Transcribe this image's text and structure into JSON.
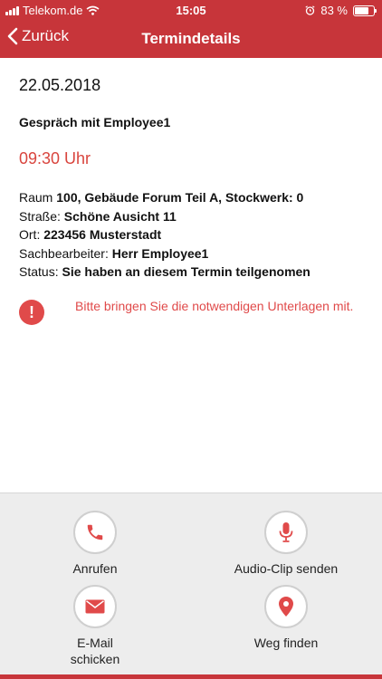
{
  "status_bar": {
    "carrier": "Telekom.de",
    "time": "15:05",
    "battery": "83 %",
    "battery_level": 0.83
  },
  "nav": {
    "back_label": "Zurück",
    "title": "Termindetails"
  },
  "appointment": {
    "date": "22.05.2018",
    "subject": "Gespräch mit Employee1",
    "time": "09:30 Uhr",
    "room_label": "Raum",
    "room_value": "100, Gebäude Forum Teil A, Stockwerk: 0",
    "street_label": "Straße:",
    "street_value": "Schöne Ausicht 11",
    "city_label": "Ort:",
    "city_value": "223456 Musterstadt",
    "agent_label": "Sachbearbeiter:",
    "agent_value": "Herr Employee1",
    "status_label": "Status:",
    "status_value": "Sie haben an diesem Termin teilgenomen"
  },
  "notice": {
    "icon_text": "!",
    "text": "Bitte bringen Sie die notwendigen Unterlagen mit."
  },
  "actions": {
    "call": "Anrufen",
    "audio": "Audio-Clip senden",
    "email_line1": "E-Mail",
    "email_line2": "schicken",
    "route": "Weg finden"
  },
  "colors": {
    "brand": "#c7353a",
    "accent": "#e04a4a"
  }
}
